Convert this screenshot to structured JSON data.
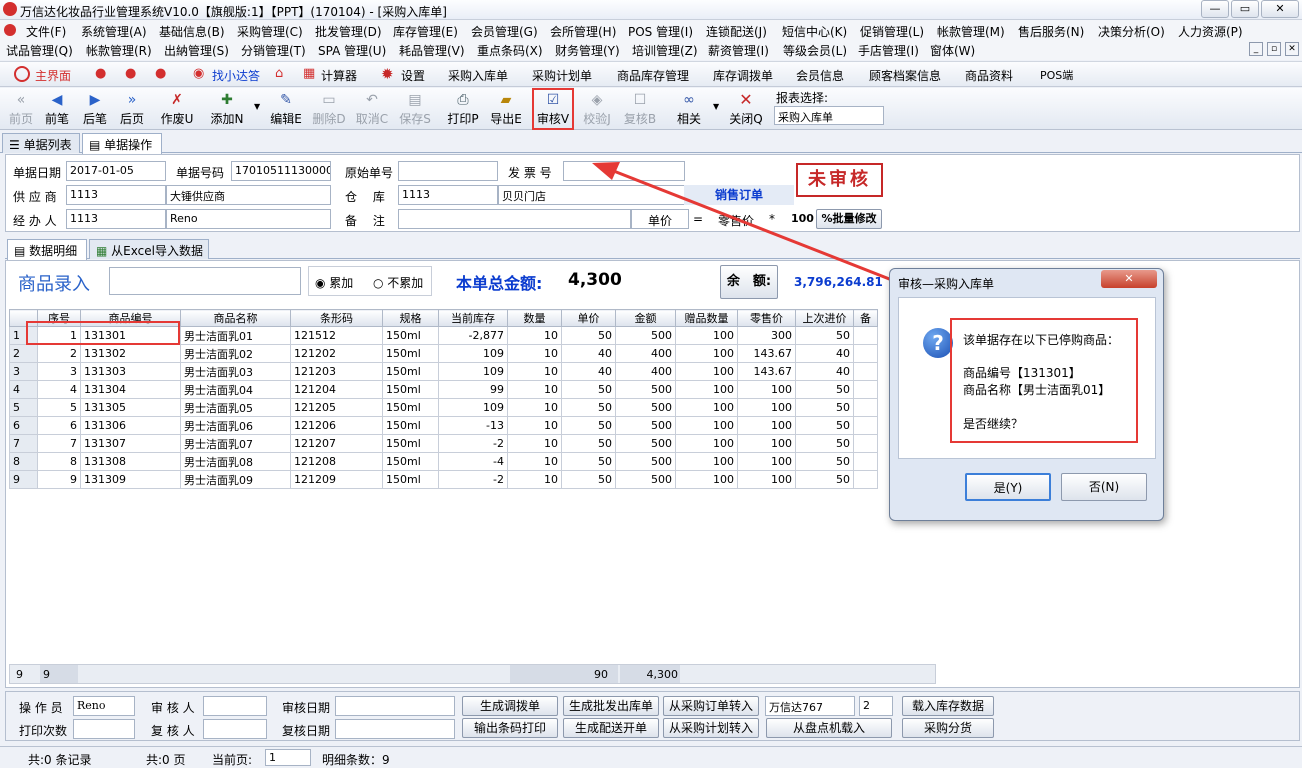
{
  "window": {
    "title": "万信达化妆品行业管理系统V10.0【旗舰版:1】【PPT】(170104) - [采购入库单]",
    "controls": [
      "—",
      "▭",
      "✕"
    ]
  },
  "menu": {
    "row1": [
      "文件(F)",
      "系统管理(A)",
      "基础信息(B)",
      "采购管理(C)",
      "批发管理(D)",
      "库存管理(E)",
      "会员管理(G)",
      "会所管理(H)",
      "POS 管理(I)",
      "连锁配送(J)",
      "短信中心(K)",
      "促销管理(L)",
      "帐款管理(M)",
      "售后服务(N)",
      "决策分析(O)",
      "人力资源(P)"
    ],
    "row2": [
      "试品管理(Q)",
      "帐款管理(R)",
      "出納管理(S)",
      "分销管理(T)",
      "SPA 管理(U)",
      "耗品管理(V)",
      "重点条码(X)",
      "财务管理(Y)",
      "培训管理(Z)",
      "薪资管理(I)",
      "等级会员(L)",
      "手店管理(I)",
      "窗体(W)"
    ]
  },
  "quickbar": {
    "main": "主界面",
    "find": "找小达答",
    "calc": "计算器",
    "settings": "设置",
    "links": [
      "采购入库单",
      "采购计划单",
      "商品库存管理",
      "库存调拨单",
      "会员信息",
      "顾客档案信息",
      "商品资料",
      "POS端"
    ]
  },
  "toolbar": {
    "buttons": [
      "前页",
      "前笔",
      "后笔",
      "后页",
      "作废U",
      "添加N",
      "编辑E",
      "删除D",
      "取消C",
      "保存S",
      "打印P",
      "导出E",
      "审核V",
      "校验J",
      "复核B",
      "相关",
      "关闭Q"
    ],
    "report_label": "报表选择:",
    "report_value": "采购入库单"
  },
  "tabs": [
    "单据列表",
    "单据操作"
  ],
  "form": {
    "date_label": "单据日期",
    "date": "2017-01-05",
    "no_label": "单据号码",
    "no": "1701051113000000",
    "orig_label": "原始单号",
    "orig": "",
    "invoice_label": "发 票 号",
    "invoice": "",
    "supplier_label": "供 应 商",
    "supplier_code": "1113",
    "supplier_name": "大锤供应商",
    "warehouse_label": "仓　 库",
    "warehouse_code": "1113",
    "warehouse_name": "贝贝门店",
    "sales_order": "销售订单",
    "handler_label": "经 办 人",
    "handler_code": "1113",
    "handler_name": "Reno",
    "note_label": "备　 注",
    "note": "",
    "price_label": "单价",
    "eq": "=",
    "retail_label": "零售价",
    "times": "*",
    "pct": "100",
    "batch_btn": "%批量修改",
    "stamp": "未审核"
  },
  "detail_tabs": [
    "数据明细",
    "从Excel导入数据"
  ],
  "entry": {
    "label": "商品录入",
    "opt1": "累加",
    "opt2": "不累加",
    "total_label": "本单总金额:",
    "total": "4,300",
    "balance_label": "余　额:",
    "balance": "3,796,264.81"
  },
  "table": {
    "headers": [
      "",
      "序号",
      "商品编号",
      "商品名称",
      "条形码",
      "规格",
      "当前库存",
      "数量",
      "单价",
      "金额",
      "赠品数量",
      "零售价",
      "上次进价",
      "备"
    ],
    "rows": [
      [
        "1",
        "1",
        "131301",
        "男士洁面乳01",
        "121512",
        "150ml",
        "-2,877",
        "10",
        "50",
        "500",
        "100",
        "300",
        "50"
      ],
      [
        "2",
        "2",
        "131302",
        "男士洁面乳02",
        "121202",
        "150ml",
        "109",
        "10",
        "40",
        "400",
        "100",
        "143.67",
        "40"
      ],
      [
        "3",
        "3",
        "131303",
        "男士洁面乳03",
        "121203",
        "150ml",
        "109",
        "10",
        "40",
        "400",
        "100",
        "143.67",
        "40"
      ],
      [
        "4",
        "4",
        "131304",
        "男士洁面乳04",
        "121204",
        "150ml",
        "99",
        "10",
        "50",
        "500",
        "100",
        "100",
        "50"
      ],
      [
        "5",
        "5",
        "131305",
        "男士洁面乳05",
        "121205",
        "150ml",
        "109",
        "10",
        "50",
        "500",
        "100",
        "100",
        "50"
      ],
      [
        "6",
        "6",
        "131306",
        "男士洁面乳06",
        "121206",
        "150ml",
        "-13",
        "10",
        "50",
        "500",
        "100",
        "100",
        "50"
      ],
      [
        "7",
        "7",
        "131307",
        "男士洁面乳07",
        "121207",
        "150ml",
        "-2",
        "10",
        "50",
        "500",
        "100",
        "100",
        "50"
      ],
      [
        "8",
        "8",
        "131308",
        "男士洁面乳08",
        "121208",
        "150ml",
        "-4",
        "10",
        "50",
        "500",
        "100",
        "100",
        "50"
      ],
      [
        "9",
        "9",
        "131309",
        "男士洁面乳09",
        "121209",
        "150ml",
        "-2",
        "10",
        "50",
        "500",
        "100",
        "100",
        "50"
      ]
    ],
    "footer": {
      "count_a": "9",
      "count_b": "9",
      "qty": "90",
      "amount": "4,300"
    }
  },
  "footer": {
    "operator_label": "操 作 员",
    "operator": "Reno",
    "audit_label": "审 核 人",
    "audit_date_label": "审核日期",
    "print_label": "打印次数",
    "review_label": "复 核 人",
    "review_date_label": "复核日期",
    "btn1": "生成调拨单",
    "btn2": "生成批发出库单",
    "btn3": "从采购订单转入",
    "btn4": "输出条码打印",
    "btn5": "生成配送开单",
    "btn6": "从采购计划转入",
    "company": "万信达767",
    "num": "2",
    "btn7": "载入库存数据",
    "btn8": "从盘点机载入",
    "btn9": "采购分货"
  },
  "status": {
    "records": "共:0 条记录",
    "pages": "共:0 页",
    "current_label": "当前页:",
    "current": "1",
    "details": "明细条数：9"
  },
  "dialog": {
    "title": "审核—采购入库单",
    "line1": "该单据存在以下已停购商品：",
    "line2": "商品编号【131301】",
    "line3": "商品名称【男士洁面乳01】",
    "line4": "是否继续？",
    "yes": "是(Y)",
    "no": "否(N)"
  },
  "colors": {
    "accent": "#e53935",
    "link": "#0b3ccf",
    "stamp": "#c62828"
  }
}
